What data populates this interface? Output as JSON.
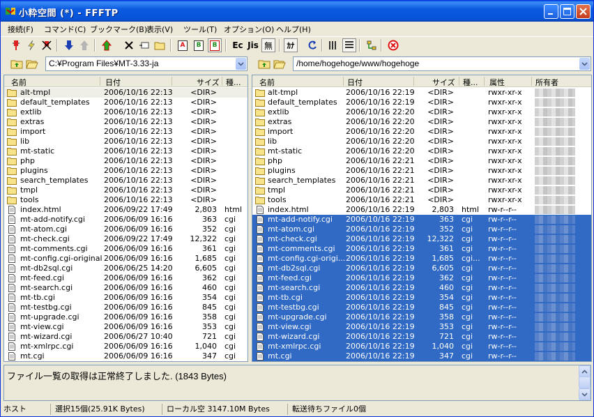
{
  "window": {
    "title": "小粋空間 (*) - FFFTP"
  },
  "menu": [
    "接続(F)",
    "コマンド(C)",
    "ブックマーク(B)",
    "表示(V)",
    "ツール(T)",
    "オプション(O)",
    "ヘルプ(H)"
  ],
  "toolbar": {
    "icons": [
      "connect-icon",
      "quick-connect-icon",
      "disconnect-icon",
      "download-icon",
      "upload-icon",
      "mirror-upload-icon",
      "delete-icon",
      "rename-icon",
      "mkdir-icon",
      "ascii-mode-icon",
      "binary-mode-icon",
      "auto-mode-icon",
      "exec-icon",
      "jis-icon",
      "no-convert-icon",
      "kana-convert-icon",
      "refresh-icon",
      "list-view-icon",
      "detail-view-icon",
      "sync-dir-icon",
      "stop-icon"
    ],
    "ascii": "A",
    "binary": "B",
    "auto": "B",
    "exec": "Ec",
    "jis": "Jis",
    "noconv": "無",
    "kana": "ｶﾅ"
  },
  "local": {
    "path": "C:¥Program Files¥MT-3.33-ja",
    "columns": {
      "name": "名前",
      "date": "日付",
      "size": "サイズ",
      "type": "種..."
    },
    "rows": [
      {
        "name": "alt-tmpl",
        "date": "2006/10/16 22:13",
        "size": "<DIR>",
        "type": "",
        "dir": true,
        "hl": true
      },
      {
        "name": "default_templates",
        "date": "2006/10/16 22:13",
        "size": "<DIR>",
        "type": "",
        "dir": true
      },
      {
        "name": "extlib",
        "date": "2006/10/16 22:13",
        "size": "<DIR>",
        "type": "",
        "dir": true
      },
      {
        "name": "extras",
        "date": "2006/10/16 22:13",
        "size": "<DIR>",
        "type": "",
        "dir": true
      },
      {
        "name": "import",
        "date": "2006/10/16 22:13",
        "size": "<DIR>",
        "type": "",
        "dir": true
      },
      {
        "name": "lib",
        "date": "2006/10/16 22:13",
        "size": "<DIR>",
        "type": "",
        "dir": true
      },
      {
        "name": "mt-static",
        "date": "2006/10/16 22:13",
        "size": "<DIR>",
        "type": "",
        "dir": true
      },
      {
        "name": "php",
        "date": "2006/10/16 22:13",
        "size": "<DIR>",
        "type": "",
        "dir": true
      },
      {
        "name": "plugins",
        "date": "2006/10/16 22:13",
        "size": "<DIR>",
        "type": "",
        "dir": true
      },
      {
        "name": "search_templates",
        "date": "2006/10/16 22:13",
        "size": "<DIR>",
        "type": "",
        "dir": true
      },
      {
        "name": "tmpl",
        "date": "2006/10/16 22:13",
        "size": "<DIR>",
        "type": "",
        "dir": true
      },
      {
        "name": "tools",
        "date": "2006/10/16 22:13",
        "size": "<DIR>",
        "type": "",
        "dir": true
      },
      {
        "name": "index.html",
        "date": "2006/09/22 17:49",
        "size": "2,803",
        "type": "html"
      },
      {
        "name": "mt-add-notify.cgi",
        "date": "2006/06/09 16:16",
        "size": "363",
        "type": "cgi"
      },
      {
        "name": "mt-atom.cgi",
        "date": "2006/06/09 16:16",
        "size": "352",
        "type": "cgi"
      },
      {
        "name": "mt-check.cgi",
        "date": "2006/09/22 17:49",
        "size": "12,322",
        "type": "cgi"
      },
      {
        "name": "mt-comments.cgi",
        "date": "2006/06/09 16:16",
        "size": "361",
        "type": "cgi"
      },
      {
        "name": "mt-config.cgi-original",
        "date": "2006/06/09 16:16",
        "size": "1,685",
        "type": "cgi"
      },
      {
        "name": "mt-db2sql.cgi",
        "date": "2006/06/25 14:20",
        "size": "6,605",
        "type": "cgi"
      },
      {
        "name": "mt-feed.cgi",
        "date": "2006/06/09 16:16",
        "size": "362",
        "type": "cgi"
      },
      {
        "name": "mt-search.cgi",
        "date": "2006/06/09 16:16",
        "size": "460",
        "type": "cgi"
      },
      {
        "name": "mt-tb.cgi",
        "date": "2006/06/09 16:16",
        "size": "354",
        "type": "cgi"
      },
      {
        "name": "mt-testbg.cgi",
        "date": "2006/06/09 16:16",
        "size": "845",
        "type": "cgi"
      },
      {
        "name": "mt-upgrade.cgi",
        "date": "2006/06/09 16:16",
        "size": "358",
        "type": "cgi"
      },
      {
        "name": "mt-view.cgi",
        "date": "2006/06/09 16:16",
        "size": "353",
        "type": "cgi"
      },
      {
        "name": "mt-wizard.cgi",
        "date": "2006/06/27 10:40",
        "size": "721",
        "type": "cgi"
      },
      {
        "name": "mt-xmlrpc.cgi",
        "date": "2006/06/09 16:16",
        "size": "1,040",
        "type": "cgi"
      },
      {
        "name": "mt.cgi",
        "date": "2006/06/09 16:16",
        "size": "347",
        "type": "cgi"
      }
    ]
  },
  "remote": {
    "path": "/home/hogehoge/www/hogehoge",
    "columns": {
      "name": "名前",
      "date": "日付",
      "size": "サイズ",
      "type": "種...",
      "attr": "属性",
      "owner": "所有者"
    },
    "rows": [
      {
        "name": "alt-tmpl",
        "date": "2006/10/16 22:19",
        "size": "<DIR>",
        "type": "",
        "attr": "rwxr-xr-x",
        "dir": true
      },
      {
        "name": "default_templates",
        "date": "2006/10/16 22:19",
        "size": "<DIR>",
        "type": "",
        "attr": "rwxr-xr-x",
        "dir": true
      },
      {
        "name": "extlib",
        "date": "2006/10/16 22:20",
        "size": "<DIR>",
        "type": "",
        "attr": "rwxr-xr-x",
        "dir": true
      },
      {
        "name": "extras",
        "date": "2006/10/16 22:20",
        "size": "<DIR>",
        "type": "",
        "attr": "rwxr-xr-x",
        "dir": true
      },
      {
        "name": "import",
        "date": "2006/10/16 22:20",
        "size": "<DIR>",
        "type": "",
        "attr": "rwxr-xr-x",
        "dir": true
      },
      {
        "name": "lib",
        "date": "2006/10/16 22:20",
        "size": "<DIR>",
        "type": "",
        "attr": "rwxr-xr-x",
        "dir": true
      },
      {
        "name": "mt-static",
        "date": "2006/10/16 22:20",
        "size": "<DIR>",
        "type": "",
        "attr": "rwxr-xr-x",
        "dir": true
      },
      {
        "name": "php",
        "date": "2006/10/16 22:21",
        "size": "<DIR>",
        "type": "",
        "attr": "rwxr-xr-x",
        "dir": true
      },
      {
        "name": "plugins",
        "date": "2006/10/16 22:21",
        "size": "<DIR>",
        "type": "",
        "attr": "rwxr-xr-x",
        "dir": true
      },
      {
        "name": "search_templates",
        "date": "2006/10/16 22:21",
        "size": "<DIR>",
        "type": "",
        "attr": "rwxr-xr-x",
        "dir": true
      },
      {
        "name": "tmpl",
        "date": "2006/10/16 22:21",
        "size": "<DIR>",
        "type": "",
        "attr": "rwxr-xr-x",
        "dir": true
      },
      {
        "name": "tools",
        "date": "2006/10/16 22:21",
        "size": "<DIR>",
        "type": "",
        "attr": "rwxr-xr-x",
        "dir": true
      },
      {
        "name": "index.html",
        "date": "2006/10/16 22:19",
        "size": "2,803",
        "type": "html",
        "attr": "rw-r--r--"
      },
      {
        "name": "mt-add-notify.cgi",
        "date": "2006/10/16 22:19",
        "size": "363",
        "type": "cgi",
        "attr": "rw-r--r--",
        "sel": true
      },
      {
        "name": "mt-atom.cgi",
        "date": "2006/10/16 22:19",
        "size": "352",
        "type": "cgi",
        "attr": "rw-r--r--",
        "sel": true
      },
      {
        "name": "mt-check.cgi",
        "date": "2006/10/16 22:19",
        "size": "12,322",
        "type": "cgi",
        "attr": "rw-r--r--",
        "sel": true
      },
      {
        "name": "mt-comments.cgi",
        "date": "2006/10/16 22:19",
        "size": "361",
        "type": "cgi",
        "attr": "rw-r--r--",
        "sel": true
      },
      {
        "name": "mt-config.cgi-origi...",
        "date": "2006/10/16 22:19",
        "size": "1,685",
        "type": "cgi...",
        "attr": "rw-r--r--",
        "sel": true
      },
      {
        "name": "mt-db2sql.cgi",
        "date": "2006/10/16 22:19",
        "size": "6,605",
        "type": "cgi",
        "attr": "rw-r--r--",
        "sel": true
      },
      {
        "name": "mt-feed.cgi",
        "date": "2006/10/16 22:19",
        "size": "362",
        "type": "cgi",
        "attr": "rw-r--r--",
        "sel": true
      },
      {
        "name": "mt-search.cgi",
        "date": "2006/10/16 22:19",
        "size": "460",
        "type": "cgi",
        "attr": "rw-r--r--",
        "sel": true
      },
      {
        "name": "mt-tb.cgi",
        "date": "2006/10/16 22:19",
        "size": "354",
        "type": "cgi",
        "attr": "rw-r--r--",
        "sel": true
      },
      {
        "name": "mt-testbg.cgi",
        "date": "2006/10/16 22:19",
        "size": "845",
        "type": "cgi",
        "attr": "rw-r--r--",
        "sel": true
      },
      {
        "name": "mt-upgrade.cgi",
        "date": "2006/10/16 22:19",
        "size": "358",
        "type": "cgi",
        "attr": "rw-r--r--",
        "sel": true
      },
      {
        "name": "mt-view.cgi",
        "date": "2006/10/16 22:19",
        "size": "353",
        "type": "cgi",
        "attr": "rw-r--r--",
        "sel": true
      },
      {
        "name": "mt-wizard.cgi",
        "date": "2006/10/16 22:19",
        "size": "721",
        "type": "cgi",
        "attr": "rw-r--r--",
        "sel": true
      },
      {
        "name": "mt-xmlrpc.cgi",
        "date": "2006/10/16 22:19",
        "size": "1,040",
        "type": "cgi",
        "attr": "rw-r--r--",
        "sel": true
      },
      {
        "name": "mt.cgi",
        "date": "2006/10/16 22:19",
        "size": "347",
        "type": "cgi",
        "attr": "rw-r--r--",
        "sel": true
      }
    ]
  },
  "log": {
    "text": "ファイル一覧の取得は正常終了しました. (1843 Bytes)"
  },
  "status": {
    "host": "ホスト",
    "selection": "選択15個(25.91K Bytes)",
    "local_free": "ローカル空 3147.10M Bytes",
    "queue": "転送待ちファイル0個"
  },
  "colors": {
    "selection": "#316ac5",
    "titlebar": "#0b5ae0"
  }
}
